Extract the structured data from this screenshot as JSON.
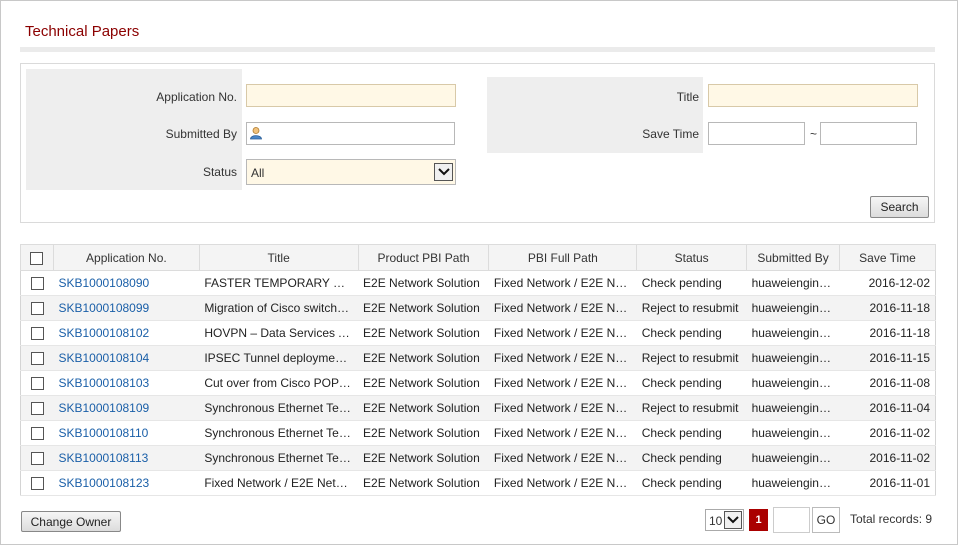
{
  "page": {
    "title": "Technical Papers"
  },
  "search": {
    "application_no_label": "Application No.",
    "application_no_value": "",
    "submitted_by_label": "Submitted By",
    "submitted_by_value": "",
    "status_label": "Status",
    "status_value": "All",
    "title_label": "Title",
    "title_value": "",
    "save_time_label": "Save Time",
    "save_time_from": "",
    "save_time_to": "",
    "range_sep": "~",
    "search_button": "Search"
  },
  "table": {
    "columns": [
      "Application No.",
      "Title",
      "Product PBI Path",
      "PBI Full Path",
      "Status",
      "Submitted By",
      "Save Time"
    ],
    "rows": [
      [
        "SKB1000108090",
        "FASTER TEMPORARY SOL…",
        "E2E Network Solution",
        "Fixed Network / E2E Ne…",
        "Check pending",
        "huaweiengin…",
        "2016-12-02"
      ],
      [
        "SKB1000108099",
        "Migration of Cisco switch…",
        "E2E Network Solution",
        "Fixed Network / E2E Ne…",
        "Reject to resubmit",
        "huaweiengin…",
        "2016-11-18"
      ],
      [
        "SKB1000108102",
        "HOVPN – Data Services A…",
        "E2E Network Solution",
        "Fixed Network / E2E Ne…",
        "Check pending",
        "huaweiengin…",
        "2016-11-18"
      ],
      [
        "SKB1000108104",
        "IPSEC Tunnel deployment…",
        "E2E Network Solution",
        "Fixed Network / E2E Ne…",
        "Reject to resubmit",
        "huaweiengin…",
        "2016-11-15"
      ],
      [
        "SKB1000108103",
        "Cut over from Cisco POP t…",
        "E2E Network Solution",
        "Fixed Network / E2E Ne…",
        "Check pending",
        "huaweiengin…",
        "2016-11-08"
      ],
      [
        "SKB1000108109",
        "Synchronous Ethernet Tec…",
        "E2E Network Solution",
        "Fixed Network / E2E Ne…",
        "Reject to resubmit",
        "huaweiengin…",
        "2016-11-04"
      ],
      [
        "SKB1000108110",
        "Synchronous Ethernet Tec…",
        "E2E Network Solution",
        "Fixed Network / E2E Ne…",
        "Check pending",
        "huaweiengin…",
        "2016-11-02"
      ],
      [
        "SKB1000108113",
        "Synchronous Ethernet Tec…",
        "E2E Network Solution",
        "Fixed Network / E2E Ne…",
        "Check pending",
        "huaweiengin…",
        "2016-11-02"
      ],
      [
        "SKB1000108123",
        "Fixed Network / E2E Net…",
        "E2E Network Solution",
        "Fixed Network / E2E Ne…",
        "Check pending",
        "huaweiengin…",
        "2016-11-01"
      ]
    ]
  },
  "footer": {
    "change_owner_button": "Change Owner",
    "page_size": "10",
    "current_page": "1",
    "page_input": "",
    "go_button": "GO",
    "total_records": "Total records: 9"
  },
  "colors": {
    "title": "#8b0000",
    "link": "#1a5fa8",
    "current_page_bg": "#aa0000",
    "highlight_input": "#fff8e6"
  },
  "icons": {
    "submitted_by": "user-picker-icon",
    "dropdown": "chevron-down-icon"
  }
}
